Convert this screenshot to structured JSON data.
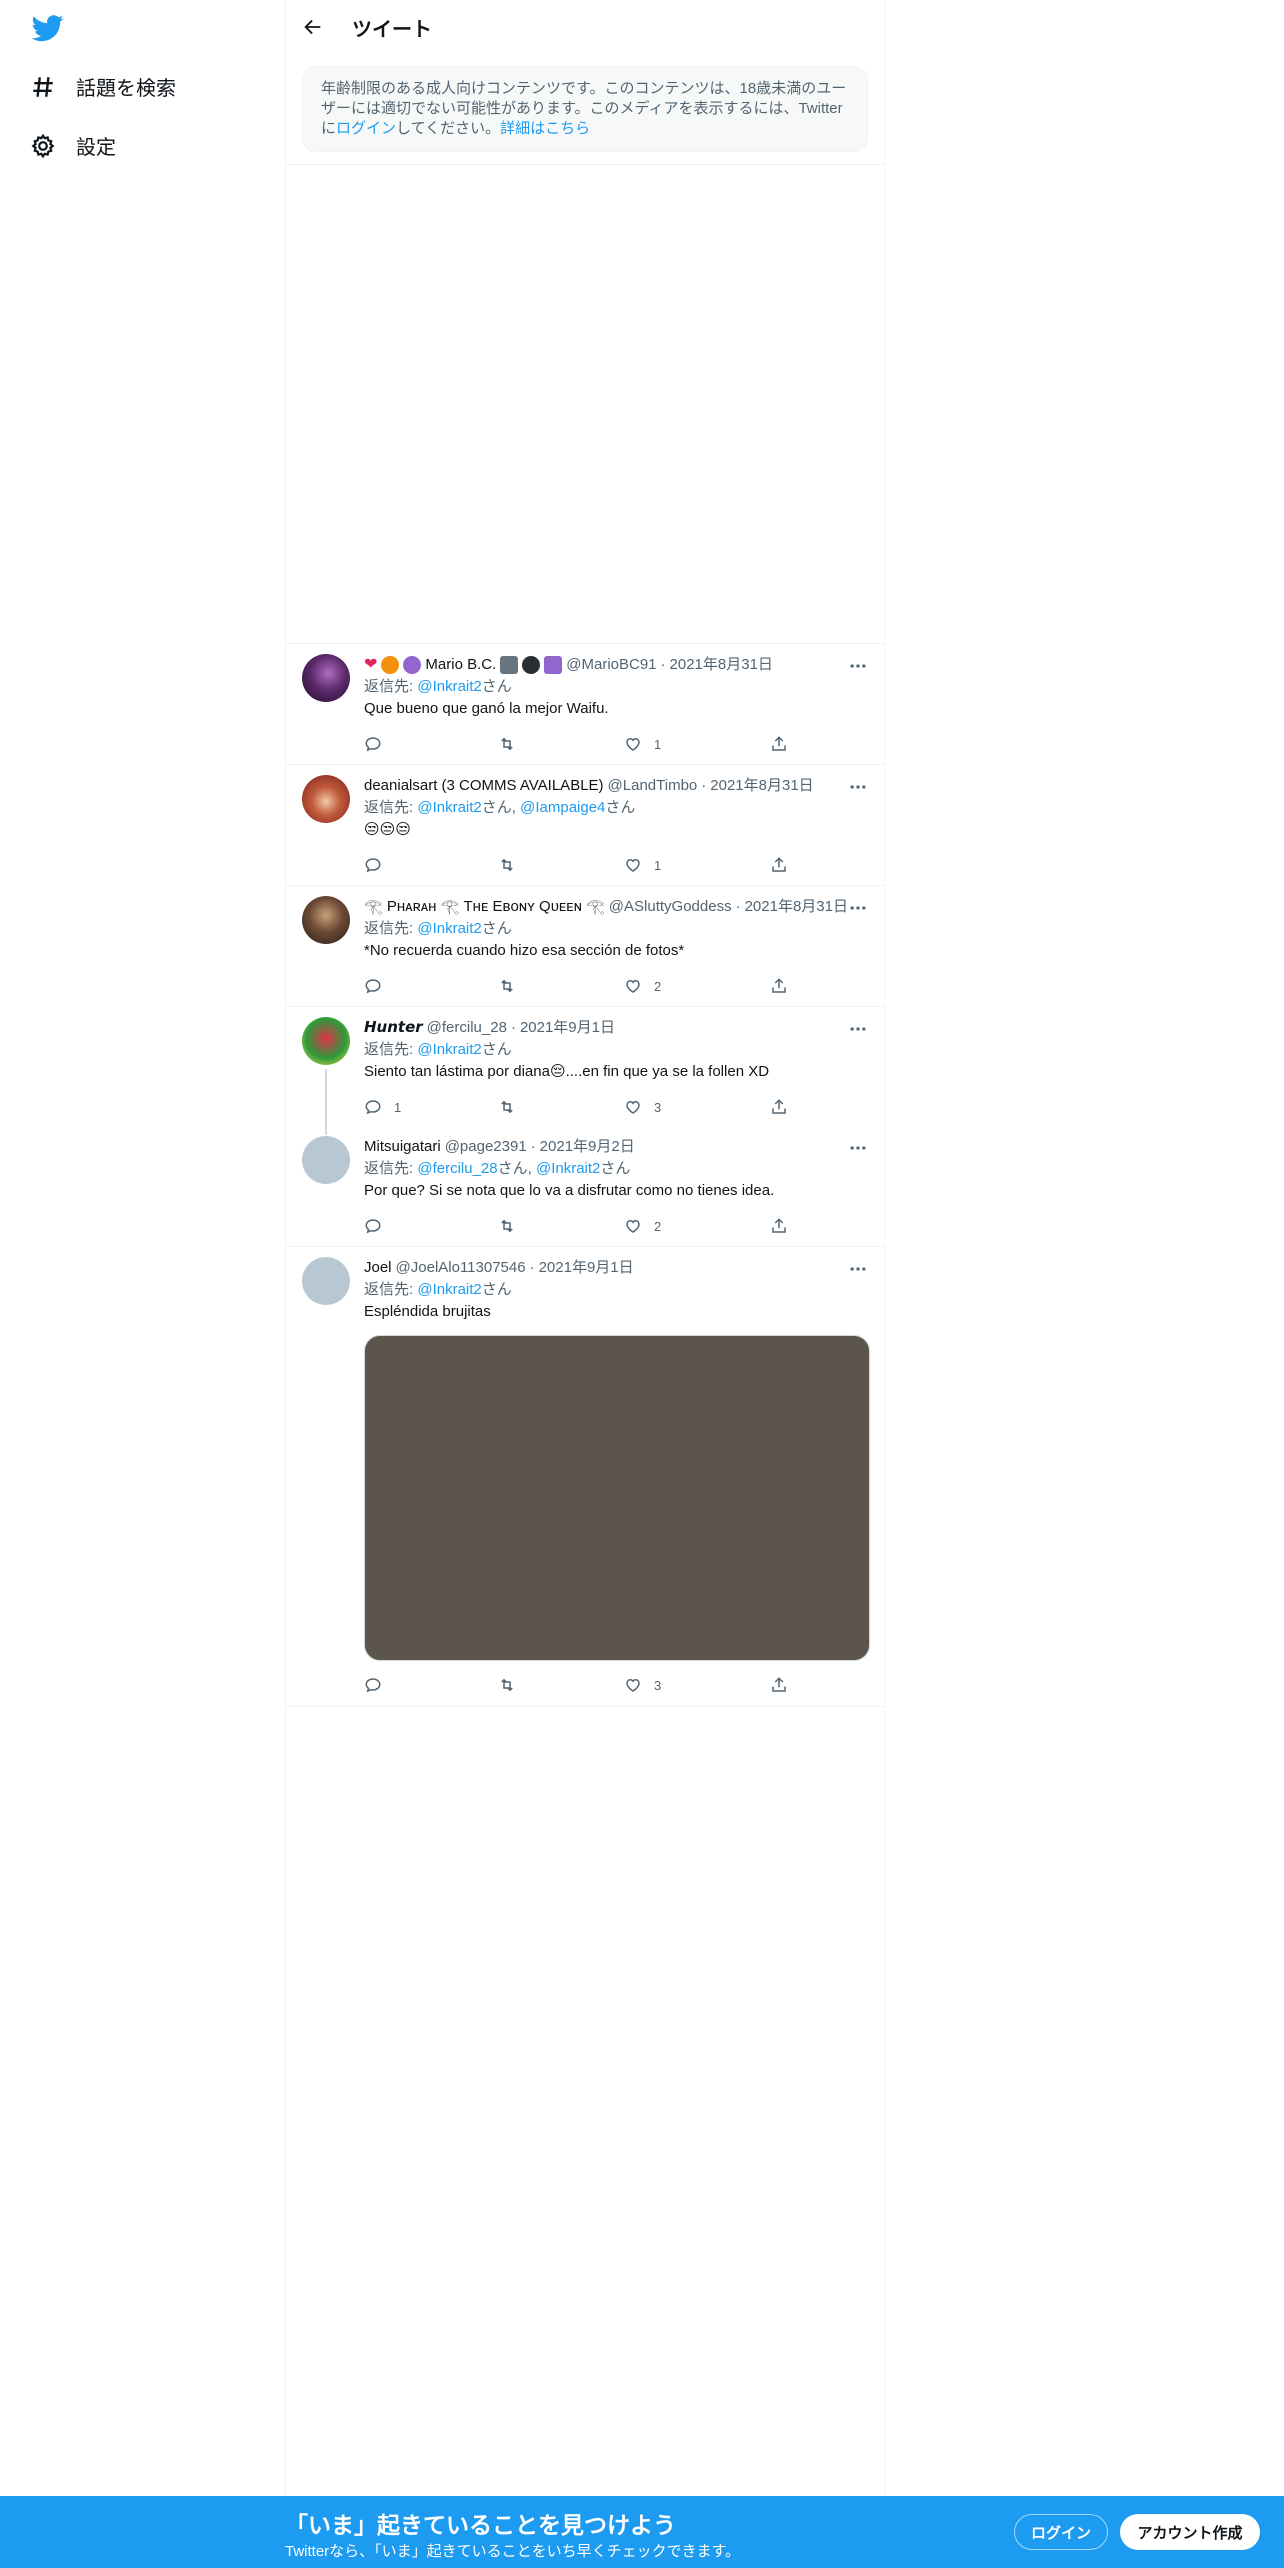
{
  "nav": {
    "logo": "twitter-bird-icon",
    "items": [
      {
        "label": "話題を検索",
        "icon": "hashtag-icon"
      },
      {
        "label": "設定",
        "icon": "gear-icon"
      }
    ]
  },
  "header": {
    "title": "ツイート",
    "back_icon": "back-arrow-icon"
  },
  "age_warning": {
    "text": "年齢制限のある成人向けコンテンツです。このコンテンツは、18歳未満のユーザーには適切でない可能性があります。このメディアを表示するには、Twitterに",
    "login_link": "ログイン",
    "text_after": "してください。",
    "details_link": "詳細はこちら"
  },
  "tweets": [
    {
      "name": "Mario B.C.",
      "handle": "@MarioBC91",
      "date": "2021年8月31日",
      "reply_prefix": "返信先: ",
      "mentions": [
        "@Inkrait2"
      ],
      "san": "さん",
      "text": "Que bueno que ganó la mejor Waifu.",
      "replies": "",
      "retweets": "",
      "likes": "1"
    },
    {
      "name": "deanialsart (3 COMMS AVAILABLE)",
      "handle": "@LandTimbo",
      "date": "2021年8月31日",
      "reply_prefix": "返信先: ",
      "mentions": [
        "@Inkrait2",
        "@Iampaige4"
      ],
      "san": "さん",
      "text": "😒😒😒",
      "replies": "",
      "retweets": "",
      "likes": "1"
    },
    {
      "name": "𓂀 Pʜᴀʀᴀʜ 𓂀 Tʜᴇ Eʙᴏɴʏ Qᴜᴇᴇɴ 𓂀",
      "handle": "@ASluttyGoddess",
      "date": "2021年8月31日",
      "reply_prefix": "返信先: ",
      "mentions": [
        "@Inkrait2"
      ],
      "san": "さん",
      "text": "*No recuerda cuando hizo esa sección de fotos*",
      "replies": "",
      "retweets": "",
      "likes": "2"
    },
    {
      "name": "𝙃𝙪𝙣𝙩𝙚𝙧",
      "handle": "@fercilu_28",
      "date": "2021年9月1日",
      "reply_prefix": "返信先: ",
      "mentions": [
        "@Inkrait2"
      ],
      "san": "さん",
      "text": "Siento tan lástima por diana😔....en fin que ya se la follen XD",
      "replies": "1",
      "retweets": "",
      "likes": "3"
    },
    {
      "name": "Mitsuigatari",
      "handle": "@page2391",
      "date": "2021年9月2日",
      "reply_prefix": "返信先: ",
      "mentions": [
        "@fercilu_28",
        "@Inkrait2"
      ],
      "san": "さん",
      "text": "Por que? Si se nota que lo va a disfrutar como no tienes idea.",
      "replies": "",
      "retweets": "",
      "likes": "2"
    },
    {
      "name": "Joel",
      "handle": "@JoelAlo11307546",
      "date": "2021年9月1日",
      "reply_prefix": "返信先: ",
      "mentions": [
        "@Inkrait2"
      ],
      "san": "さん",
      "text": "Espléndida brujitas",
      "replies": "",
      "retweets": "",
      "likes": "3"
    }
  ],
  "separator": " · ",
  "comma": ", ",
  "bottom_bar": {
    "title": "「いま」起きていることを見つけよう",
    "subtitle": "Twitterなら、「いま」起きていることをいち早くチェックできます。",
    "login": "ログイン",
    "signup": "アカウント作成"
  },
  "colors": {
    "accent": "#1d9bf0",
    "text": "#0f1419",
    "muted": "#536471",
    "media": "#5c554b"
  }
}
